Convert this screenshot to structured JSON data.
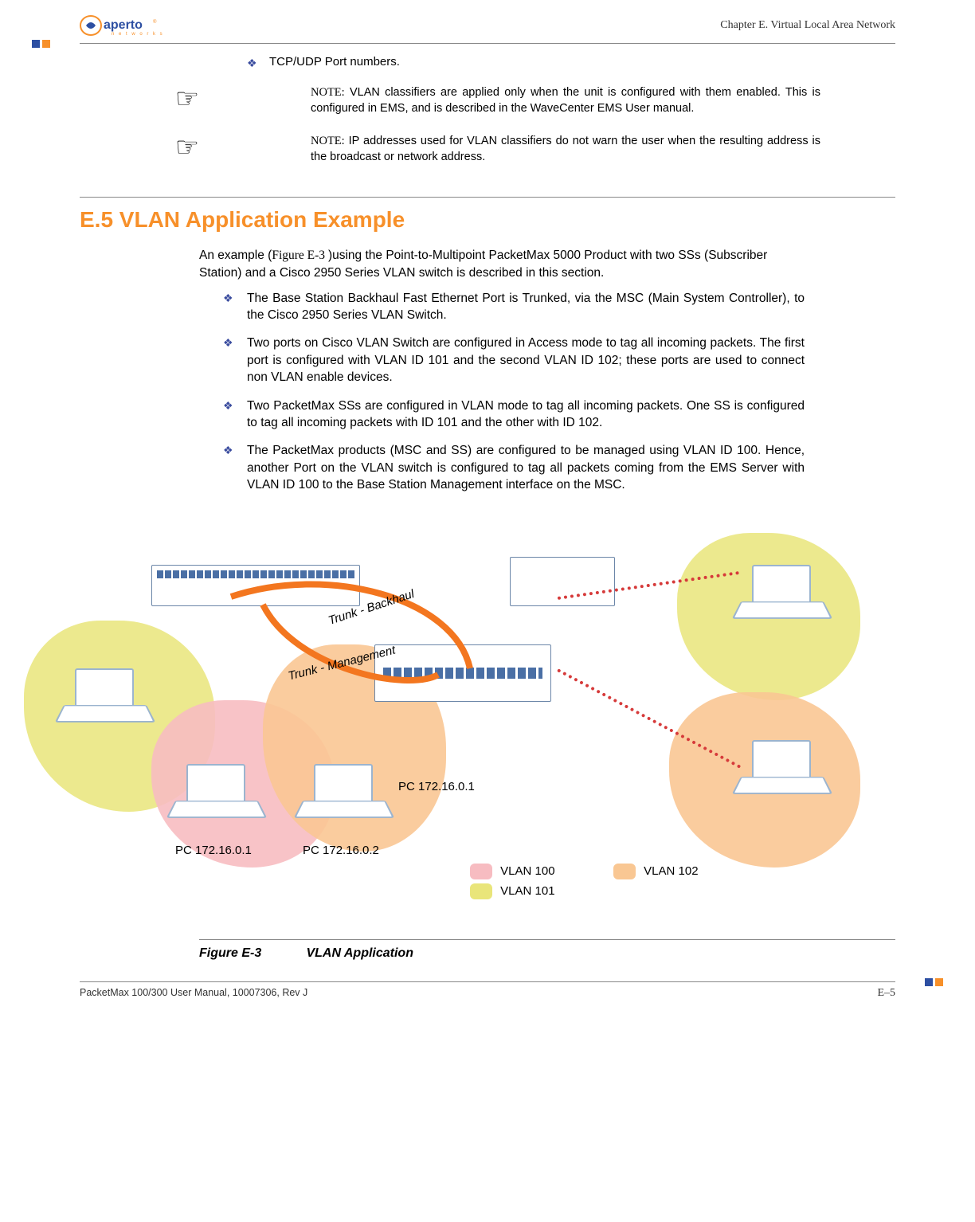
{
  "header": {
    "chapter": "Chapter E.  Virtual Local Area Network"
  },
  "top_bullet": "TCP/UDP Port numbers.",
  "notes": {
    "prefix": "NOTE:",
    "note1": "VLAN classifiers are applied only when the unit is configured with them enabled. This is configured in EMS, and is described in the WaveCenter EMS User manual.",
    "note2": "IP addresses used for VLAN classifiers do not warn the user when the resulting address is the broadcast or network address."
  },
  "section": {
    "heading": "E.5 VLAN Application Example",
    "intro_pre": "An example (",
    "intro_figref": "Figure E-3 ",
    "intro_post": ")using the Point-to-Multipoint PacketMax 5000 Product with two SSs (Subscriber Station) and a Cisco 2950 Series VLAN switch is described in this section."
  },
  "bullets": [
    "The Base Station Backhaul Fast Ethernet Port is Trunked, via the MSC (Main System Controller), to the Cisco 2950 Series VLAN Switch.",
    "Two ports on Cisco VLAN Switch are configured in Access mode to tag all incoming packets. The first port is configured with VLAN ID 101 and the second VLAN ID 102; these ports are used to connect non VLAN enable devices.",
    "Two PacketMax SSs are configured in VLAN mode to tag all incoming packets. One SS is configured to tag all incoming packets with ID 101 and the other with ID 102.",
    "The PacketMax products (MSC and SS) are configured to be managed using VLAN ID 100. Hence, another Port on the VLAN switch is configured to tag all packets coming from the EMS Server with VLAN ID 100 to the Base Station Management interface on the MSC."
  ],
  "figure": {
    "trunk_backhaul": "Trunk - Backhaul",
    "trunk_mgmt": "Trunk - Management",
    "pc_a": "PC 172.16.0.1",
    "pc_b": "PC 172.16.0.1",
    "pc_c": "PC 172.16.0.2",
    "legend_vlan100": "VLAN 100",
    "legend_vlan101": "VLAN 101",
    "legend_vlan102": "VLAN 102",
    "caption_num": "Figure E-3",
    "caption_title": "VLAN Application"
  },
  "footer": {
    "left": "PacketMax 100/300 User Manual, 10007306, Rev J",
    "right": "E–5"
  }
}
